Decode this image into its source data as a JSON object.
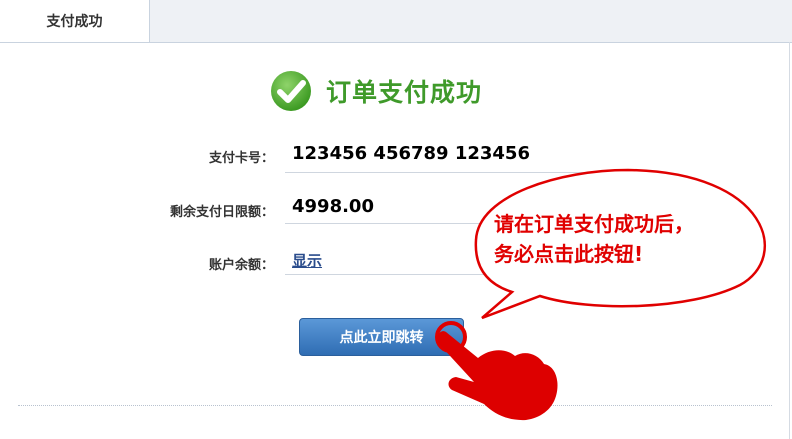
{
  "tab": {
    "label": "支付成功"
  },
  "success": {
    "title": "订单支付成功"
  },
  "fields": {
    "card_label": "支付卡号：",
    "card_value": "123456 456789 123456",
    "limit_label": "剩余支付日限额：",
    "limit_value": "4998.00",
    "balance_label": "账户余额：",
    "balance_link": "显示"
  },
  "button": {
    "label": "点此立即跳转"
  },
  "callout": {
    "line1": "请在订单支付成功后，",
    "line2": "务必点击此按钮!"
  },
  "colors": {
    "success_green": "#3f9a2a",
    "callout_red": "#e00000",
    "button_blue": "#3a7cc4"
  }
}
